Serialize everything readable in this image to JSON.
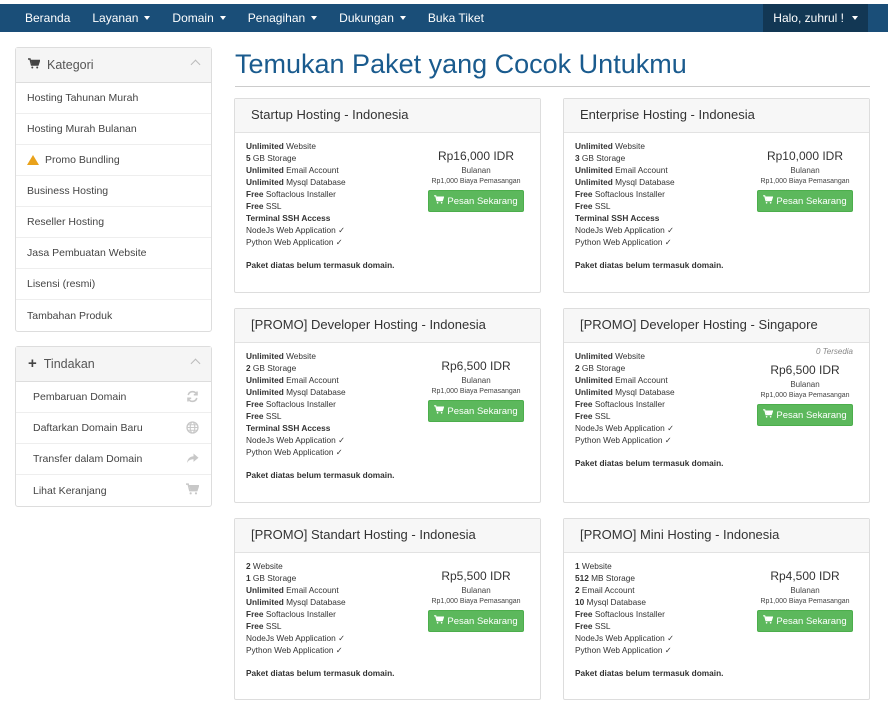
{
  "navbar": {
    "items": [
      "Beranda",
      "Layanan",
      "Domain",
      "Penagihan",
      "Dukungan",
      "Buka Tiket"
    ],
    "user_label": "Halo, zuhrul !"
  },
  "sidebar": {
    "categories": {
      "title": "Kategori",
      "items": [
        "Hosting Tahunan Murah",
        "Hosting Murah Bulanan",
        "Promo Bundling",
        "Business Hosting",
        "Reseller Hosting",
        "Jasa Pembuatan Website",
        "Lisensi (resmi)",
        "Tambahan Produk"
      ]
    },
    "actions": {
      "title": "Tindakan",
      "items": [
        {
          "label": "Pembaruan Domain",
          "icon": "refresh-icon"
        },
        {
          "label": "Daftarkan Domain Baru",
          "icon": "globe-icon"
        },
        {
          "label": "Transfer dalam Domain",
          "icon": "share-arrow-icon"
        },
        {
          "label": "Lihat Keranjang",
          "icon": "cart-icon"
        }
      ]
    }
  },
  "main": {
    "title": "Temukan Paket yang Cocok Untukmu",
    "order_label": "Pesan Sekarang",
    "period_label": "Bulanan",
    "note": "Paket diatas belum termasuk domain.",
    "products": [
      {
        "name": "Startup Hosting - Indonesia",
        "availability": "",
        "price": "Rp16,000 IDR",
        "setup": "Rp1,000 Biaya Pemasangan",
        "features": [
          [
            "Unlimited",
            " Website"
          ],
          [
            "5",
            " GB Storage"
          ],
          [
            "Unlimited",
            " Email Account"
          ],
          [
            "Unlimited",
            " Mysql Database"
          ],
          [
            "Free",
            " Softaclous Installer"
          ],
          [
            "Free",
            " SSL"
          ],
          [
            "Terminal SSH Access",
            ""
          ],
          [
            "",
            "NodeJs Web Application ✓"
          ],
          [
            "",
            "Python Web Application ✓"
          ]
        ]
      },
      {
        "name": "Enterprise Hosting - Indonesia",
        "availability": "",
        "price": "Rp10,000 IDR",
        "setup": "Rp1,000 Biaya Pemasangan",
        "features": [
          [
            "Unlimited",
            " Website"
          ],
          [
            "3",
            " GB Storage"
          ],
          [
            "Unlimited",
            " Email Account"
          ],
          [
            "Unlimited",
            " Mysql Database"
          ],
          [
            "Free",
            " Softaclous Installer"
          ],
          [
            "Free",
            " SSL"
          ],
          [
            "Terminal SSH Access",
            ""
          ],
          [
            "",
            "NodeJs Web Application ✓"
          ],
          [
            "",
            "Python Web Application ✓"
          ]
        ]
      },
      {
        "name": "[PROMO] Developer Hosting - Indonesia",
        "availability": "",
        "price": "Rp6,500 IDR",
        "setup": "Rp1,000 Biaya Pemasangan",
        "features": [
          [
            "Unlimited",
            " Website"
          ],
          [
            "2",
            " GB Storage"
          ],
          [
            "Unlimited",
            " Email Account"
          ],
          [
            "Unlimited",
            " Mysql Database"
          ],
          [
            "Free",
            " Softaclous Installer"
          ],
          [
            "Free",
            " SSL"
          ],
          [
            "Terminal SSH Access",
            ""
          ],
          [
            "",
            "NodeJs Web Application ✓"
          ],
          [
            "",
            "Python Web Application ✓"
          ]
        ]
      },
      {
        "name": "[PROMO] Developer Hosting - Singapore",
        "availability": "0 Tersedia",
        "price": "Rp6,500 IDR",
        "setup": "Rp1,000 Biaya Pemasangan",
        "features": [
          [
            "Unlimited",
            " Website"
          ],
          [
            "2",
            " GB Storage"
          ],
          [
            "Unlimited",
            " Email Account"
          ],
          [
            "Unlimited",
            " Mysql Database"
          ],
          [
            "Free",
            " Softaclous Installer"
          ],
          [
            "Free",
            " SSL"
          ],
          [
            "",
            "NodeJs Web Application ✓"
          ],
          [
            "",
            "Python Web Application ✓"
          ]
        ]
      },
      {
        "name": "[PROMO] Standart Hosting - Indonesia",
        "availability": "",
        "price": "Rp5,500 IDR",
        "setup": "Rp1,000 Biaya Pemasangan",
        "features": [
          [
            "2",
            " Website"
          ],
          [
            "1",
            " GB Storage"
          ],
          [
            "Unlimited",
            " Email Account"
          ],
          [
            "Unlimited",
            " Mysql Database"
          ],
          [
            "Free",
            " Softaclous Installer"
          ],
          [
            "Free",
            " SSL"
          ],
          [
            "",
            "NodeJs Web Application ✓"
          ],
          [
            "",
            "Python Web Application ✓"
          ]
        ]
      },
      {
        "name": "[PROMO] Mini Hosting - Indonesia",
        "availability": "",
        "price": "Rp4,500 IDR",
        "setup": "Rp1,000 Biaya Pemasangan",
        "features": [
          [
            "1",
            " Website"
          ],
          [
            "512",
            " MB Storage"
          ],
          [
            "2",
            " Email Account"
          ],
          [
            "10",
            " Mysql Database"
          ],
          [
            "Free",
            " Softaclous Installer"
          ],
          [
            "Free",
            " SSL"
          ],
          [
            "",
            "NodeJs Web Application ✓"
          ],
          [
            "",
            "Python Web Application ✓"
          ]
        ]
      }
    ]
  },
  "colors": {
    "navbar": "#1a4e78",
    "title": "#1a5b8e",
    "button": "#5cb85c"
  }
}
